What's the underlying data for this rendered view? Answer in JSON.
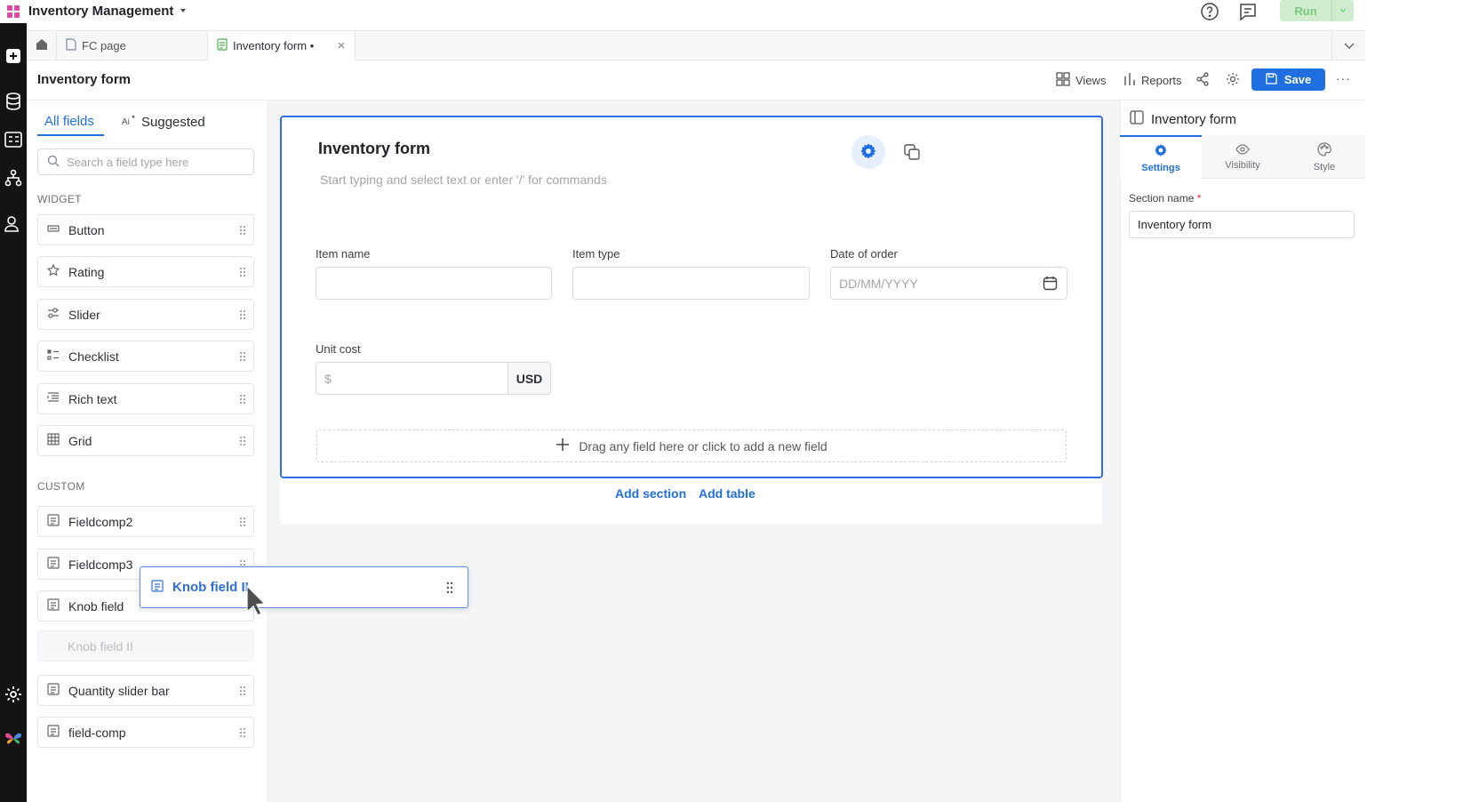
{
  "app": {
    "title": "Inventory Management"
  },
  "top_actions": {
    "run_label": "Run"
  },
  "tabs": [
    {
      "label": "FC page"
    },
    {
      "label": "Inventory form •"
    }
  ],
  "page": {
    "title": "Inventory form",
    "views_label": "Views",
    "reports_label": "Reports",
    "save_label": "Save"
  },
  "left_panel": {
    "tab_all": "All fields",
    "tab_suggested": "Suggested",
    "search_placeholder": "Search a field type here",
    "widget_group": "WIDGET",
    "widgets": [
      {
        "label": "Button",
        "icon": "button-icon"
      },
      {
        "label": "Rating",
        "icon": "star-icon"
      },
      {
        "label": "Slider",
        "icon": "slider-icon"
      },
      {
        "label": "Checklist",
        "icon": "checklist-icon"
      },
      {
        "label": "Rich text",
        "icon": "rich-text-icon"
      },
      {
        "label": "Grid",
        "icon": "grid-icon"
      }
    ],
    "custom_group": "CUSTOM",
    "custom": [
      {
        "label": "Fieldcomp2"
      },
      {
        "label": "Fieldcomp3"
      },
      {
        "label": "Knob field"
      },
      {
        "label": "Knob field II"
      },
      {
        "label": "Quantity slider bar"
      },
      {
        "label": "field-comp"
      }
    ]
  },
  "form": {
    "title": "Inventory form",
    "hint": "Start typing and select text or enter '/' for commands",
    "fields": {
      "item_name": {
        "label": "Item name",
        "value": ""
      },
      "item_type": {
        "label": "Item type",
        "value": ""
      },
      "date_of_order": {
        "label": "Date of order",
        "placeholder": "DD/MM/YYYY"
      },
      "unit_cost": {
        "label": "Unit cost",
        "placeholder": "$",
        "currency": "USD"
      }
    },
    "dropzone": "Drag any field here or click to add a new field",
    "add_section": "Add section",
    "add_table": "Add table"
  },
  "dragging": {
    "label": "Knob field II"
  },
  "right_panel": {
    "title": "Inventory form",
    "tabs": [
      "Settings",
      "Visibility",
      "Style"
    ],
    "section_name_label": "Section name",
    "required_mark": "*",
    "section_name_value": "Inventory form"
  },
  "colors": {
    "accent": "#1f6fe0",
    "run_green": "#cfeccf",
    "rail": "#141414"
  }
}
